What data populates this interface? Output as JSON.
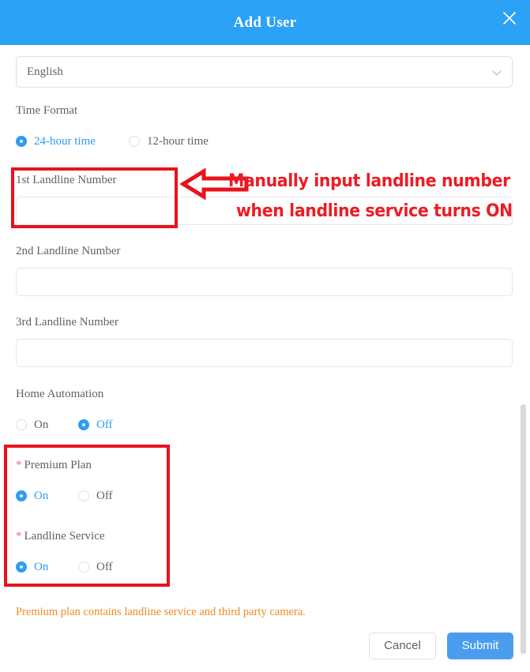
{
  "header": {
    "title": "Add User",
    "close_icon": "close-icon",
    "background_color": "#2BA2F5"
  },
  "form": {
    "language_select": {
      "value": "English",
      "icon": "chevron-down-icon"
    },
    "time_format": {
      "label": "Time Format",
      "options": [
        {
          "label": "24-hour time",
          "selected": true
        },
        {
          "label": "12-hour time",
          "selected": false
        }
      ]
    },
    "landline_1": {
      "label": "1st Landline Number",
      "value": "",
      "placeholder": ""
    },
    "landline_2": {
      "label": "2nd Landline Number",
      "value": "",
      "placeholder": ""
    },
    "landline_3": {
      "label": "3rd Landline Number",
      "value": "",
      "placeholder": ""
    },
    "home_automation": {
      "label": "Home Automation",
      "options": [
        {
          "label": "On",
          "selected": false
        },
        {
          "label": "Off",
          "selected": true
        }
      ]
    },
    "premium_plan": {
      "label": "Premium Plan",
      "required_mark": "*",
      "options": [
        {
          "label": "On",
          "selected": true
        },
        {
          "label": "Off",
          "selected": false
        }
      ]
    },
    "landline_service": {
      "label": "Landline Service",
      "required_mark": "*",
      "options": [
        {
          "label": "On",
          "selected": true
        },
        {
          "label": "Off",
          "selected": false
        }
      ]
    }
  },
  "footer": {
    "hint": "Premium plan contains landline service and third party camera.",
    "hint_color": "#F08C23",
    "cancel_label": "Cancel",
    "submit_label": "Submit",
    "submit_color": "#4A9DEE"
  },
  "annotations": {
    "color": "#EC1C24",
    "line_1": "Manually input landline number",
    "line_2": "when landline service turns ON"
  }
}
